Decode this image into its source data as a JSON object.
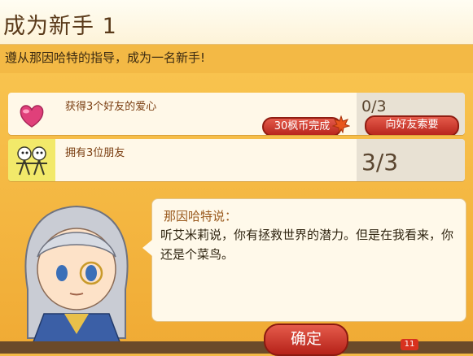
{
  "header": {
    "title": "成为新手 1"
  },
  "subtitle": "遵从那因哈特的指导，成为一名新手!",
  "tasks": [
    {
      "icon": "heart-icon",
      "name": "获得3个好友的爱心",
      "progress": "0/3",
      "coin_button": "30枫币完成",
      "ask_button": "向好友索要"
    },
    {
      "icon": "friends-icon",
      "name": "拥有3位朋友",
      "progress": "3/3"
    }
  ],
  "dialog": {
    "speaker": "那因哈特说：",
    "text": "听艾米莉说，你有拯救世界的潜力。但是在我看来，你还是个菜鸟。"
  },
  "confirm_label": "确定",
  "footer": {
    "badge": "11"
  },
  "colors": {
    "accent": "#f3b945",
    "button_red": "#c8342a",
    "text_brown": "#7a3d10"
  }
}
